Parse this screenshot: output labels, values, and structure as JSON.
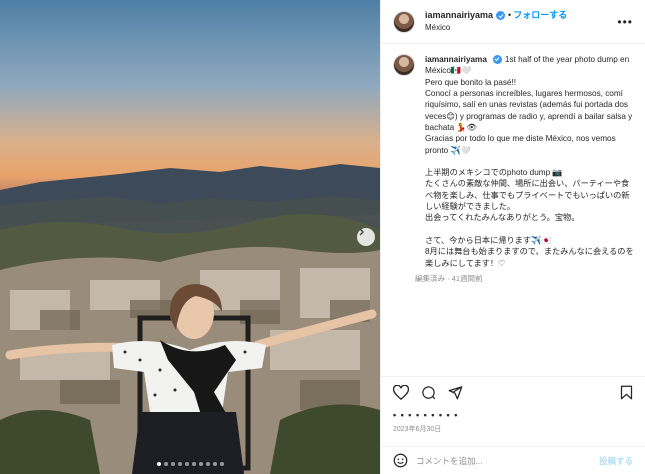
{
  "post": {
    "username": "iamannairiyama",
    "follow_label": "フォローする",
    "separator": "•",
    "location": "México",
    "more_label": "•••",
    "caption": "1st half of the year photo dump en México🇲🇽🤍\nPero que bonito la pasé!!\nConocí a personas increíbles, lugares hermosos, comí riquísimo, salí en unas revistas (además fui portada dos veces😊) y programas de radio y, aprendí a bailar salsa y bachata 💃👁\nGracias por todo lo que me diste México, nos vemos pronto ✈️🤍\n\n上半期のメキシコでのphoto dump 📷\nたくさんの素敵な仲間、場所に出会い、パーティーや食べ物を楽しみ、仕事でもプライベートでもいっぱいの新しい経験ができました。\n出会ってくれたみんなありがとう。宝物。\n\nさて、今から日本に帰ります✈️🇯🇵\n8月には舞台も始まりますので、またみんなに会えるのを楽しみにしてます！♡",
    "caption_meta": "編集済み · 41週間前",
    "likes_text": "• • • • • • • • •",
    "date": "2023年6月30日",
    "comment_placeholder": "コメントを追加...",
    "post_button": "投稿する"
  },
  "carousel": {
    "count": 10,
    "active_index": 0
  },
  "colors": {
    "accent": "#0095f6",
    "verified": "#3897f0",
    "post_disabled": "#b2dffc"
  },
  "icons": [
    "verified-icon",
    "more-icon",
    "chevron-right-icon",
    "heart-icon",
    "comment-icon",
    "share-icon",
    "bookmark-icon",
    "emoji-icon"
  ]
}
